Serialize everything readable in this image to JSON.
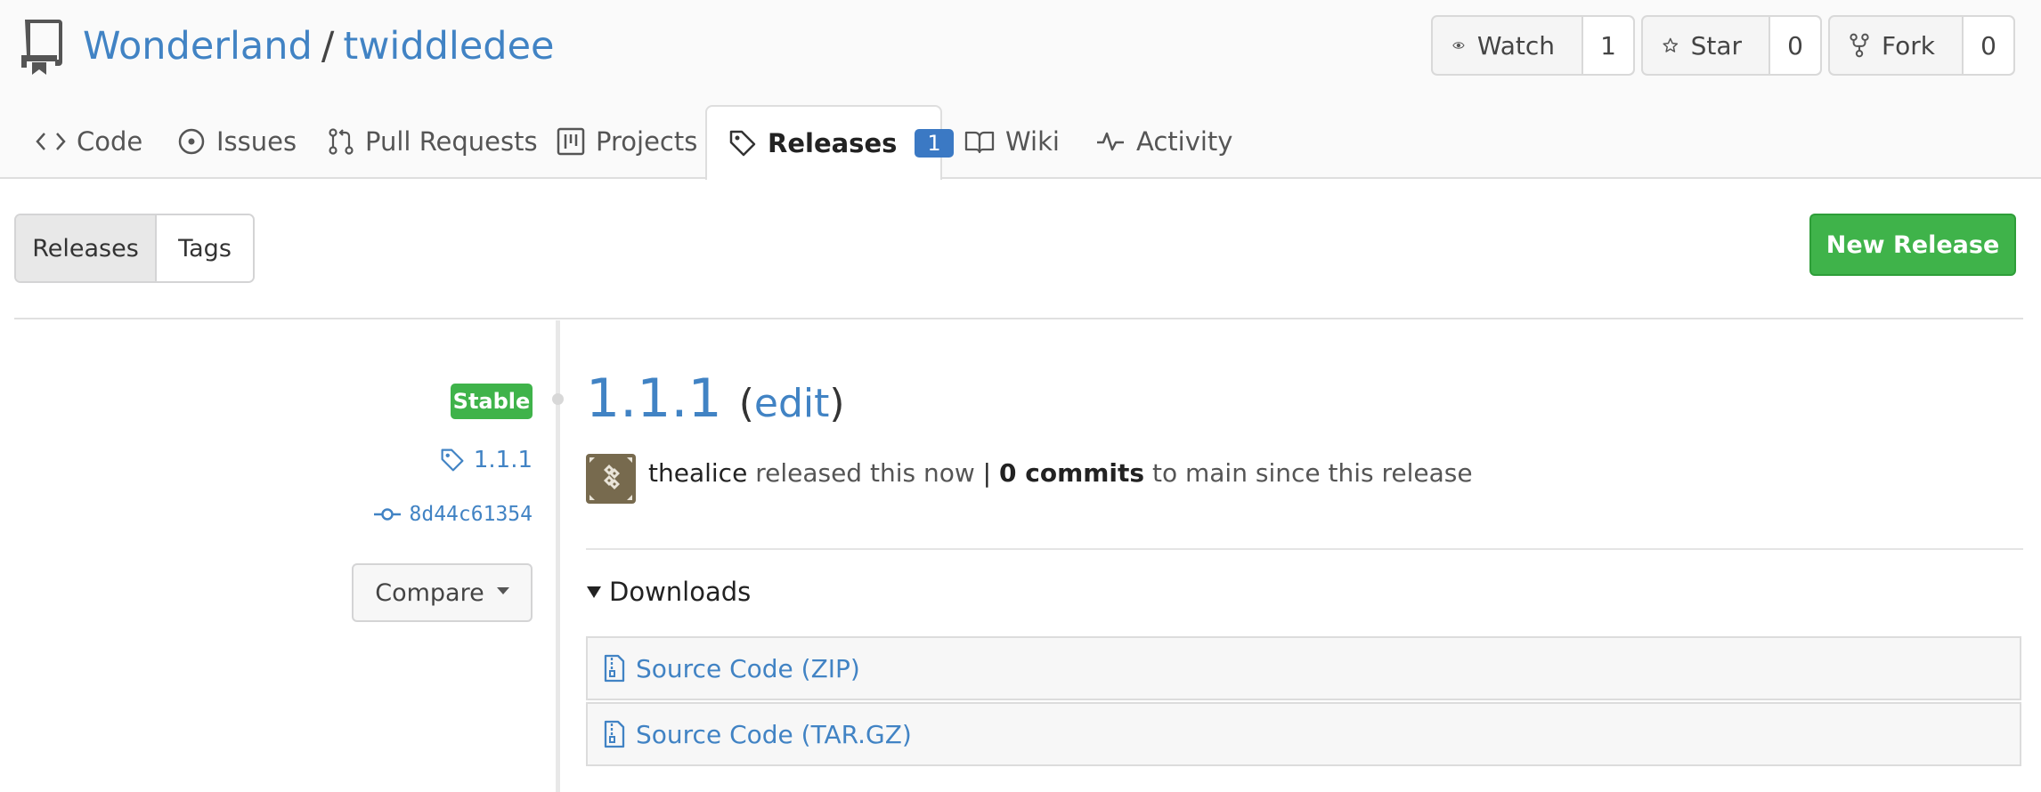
{
  "repo": {
    "owner": "Wonderland",
    "separator": "/",
    "name": "twiddledee"
  },
  "actions": {
    "watch": {
      "label": "Watch",
      "count": "1"
    },
    "star": {
      "label": "Star",
      "count": "0"
    },
    "fork": {
      "label": "Fork",
      "count": "0"
    }
  },
  "tabs": [
    {
      "label": "Code",
      "icon": "code-icon"
    },
    {
      "label": "Issues",
      "icon": "issue-icon"
    },
    {
      "label": "Pull Requests",
      "icon": "pull-request-icon"
    },
    {
      "label": "Projects",
      "icon": "project-icon"
    },
    {
      "label": "Releases",
      "icon": "tag-icon",
      "badge": "1",
      "active": true
    },
    {
      "label": "Wiki",
      "icon": "book-icon"
    },
    {
      "label": "Activity",
      "icon": "pulse-icon"
    }
  ],
  "toggle": {
    "releases": "Releases",
    "tags": "Tags"
  },
  "new_release_label": "New Release",
  "release": {
    "status_badge": "Stable",
    "tag": "1.1.1",
    "commit": "8d44c61354",
    "compare_label": "Compare",
    "title": "1.1.1",
    "edit_open": "(",
    "edit_label": "edit",
    "edit_close": ")",
    "author": "thealice",
    "released_text": "released this now",
    "pipe": "|",
    "commits_count": "0 commits",
    "since_text": "to main since this release",
    "downloads_label": "Downloads",
    "assets": [
      "Source Code (ZIP)",
      "Source Code (TAR.GZ)"
    ]
  },
  "colors": {
    "link": "#4183c4",
    "green": "#3fb34a",
    "badge_blue": "#3b79c4"
  }
}
